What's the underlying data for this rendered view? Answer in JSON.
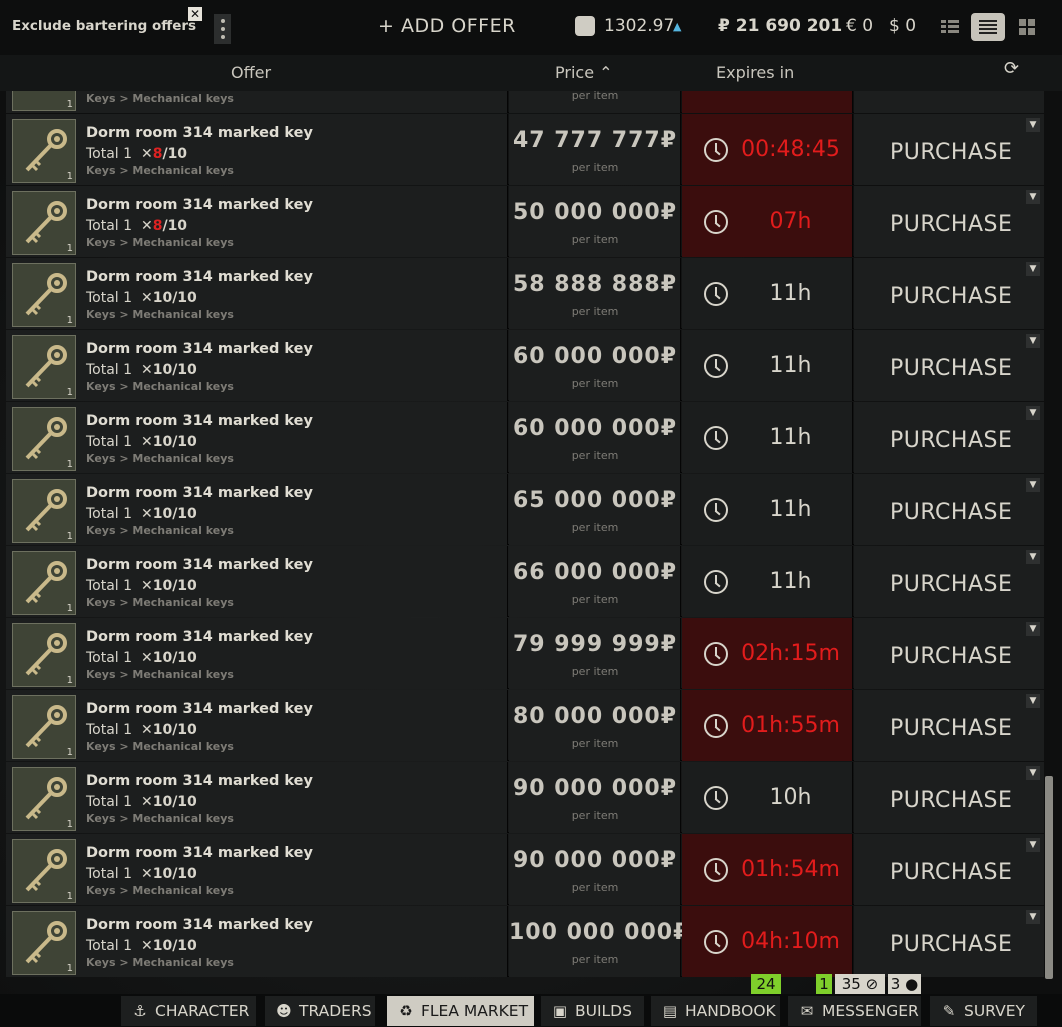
{
  "topbar": {
    "exclude_label": "Exclude bartering offers",
    "exclude_close": "✕",
    "add_offer": "+ ADD OFFER",
    "bsg_value": "1302.97",
    "bsg_arrow": "▲",
    "rubles": "₽ 21 690 201",
    "euros": "€ 0",
    "dollars": "$ 0"
  },
  "header": {
    "offer": "Offer",
    "price": "Price ⌃",
    "expires": "Expires in",
    "refresh_icon": "⟳"
  },
  "partial_row": {
    "category": "Keys > Mechanical keys",
    "per_item": "per item",
    "qty": "1"
  },
  "offers": [
    {
      "name": "Dorm room 314 marked key",
      "total": "Total 1",
      "dur_cur": "8",
      "dur_max": "/10",
      "dur_bad": true,
      "category": "Keys > Mechanical keys",
      "price": "47 777 777",
      "currency": "₽",
      "per_item": "per item",
      "expires": "00:48:45",
      "urgent": true,
      "action": "PURCHASE",
      "qty": "1"
    },
    {
      "name": "Dorm room 314 marked key",
      "total": "Total 1",
      "dur_cur": "8",
      "dur_max": "/10",
      "dur_bad": true,
      "category": "Keys > Mechanical keys",
      "price": "50 000 000",
      "currency": "₽",
      "per_item": "per item",
      "expires": "07h",
      "urgent": true,
      "action": "PURCHASE",
      "qty": "1"
    },
    {
      "name": "Dorm room 314 marked key",
      "total": "Total 1",
      "dur_cur": "10",
      "dur_max": "/10",
      "dur_bad": false,
      "category": "Keys > Mechanical keys",
      "price": "58 888 888",
      "currency": "₽",
      "per_item": "per item",
      "expires": "11h",
      "urgent": false,
      "action": "PURCHASE",
      "qty": "1"
    },
    {
      "name": "Dorm room 314 marked key",
      "total": "Total 1",
      "dur_cur": "10",
      "dur_max": "/10",
      "dur_bad": false,
      "category": "Keys > Mechanical keys",
      "price": "60 000 000",
      "currency": "₽",
      "per_item": "per item",
      "expires": "11h",
      "urgent": false,
      "action": "PURCHASE",
      "qty": "1"
    },
    {
      "name": "Dorm room 314 marked key",
      "total": "Total 1",
      "dur_cur": "10",
      "dur_max": "/10",
      "dur_bad": false,
      "category": "Keys > Mechanical keys",
      "price": "60 000 000",
      "currency": "₽",
      "per_item": "per item",
      "expires": "11h",
      "urgent": false,
      "action": "PURCHASE",
      "qty": "1"
    },
    {
      "name": "Dorm room 314 marked key",
      "total": "Total 1",
      "dur_cur": "10",
      "dur_max": "/10",
      "dur_bad": false,
      "category": "Keys > Mechanical keys",
      "price": "65 000 000",
      "currency": "₽",
      "per_item": "per item",
      "expires": "11h",
      "urgent": false,
      "action": "PURCHASE",
      "qty": "1"
    },
    {
      "name": "Dorm room 314 marked key",
      "total": "Total 1",
      "dur_cur": "10",
      "dur_max": "/10",
      "dur_bad": false,
      "category": "Keys > Mechanical keys",
      "price": "66 000 000",
      "currency": "₽",
      "per_item": "per item",
      "expires": "11h",
      "urgent": false,
      "action": "PURCHASE",
      "qty": "1"
    },
    {
      "name": "Dorm room 314 marked key",
      "total": "Total 1",
      "dur_cur": "10",
      "dur_max": "/10",
      "dur_bad": false,
      "category": "Keys > Mechanical keys",
      "price": "79 999 999",
      "currency": "₽",
      "per_item": "per item",
      "expires": "02h:15m",
      "urgent": true,
      "action": "PURCHASE",
      "qty": "1"
    },
    {
      "name": "Dorm room 314 marked key",
      "total": "Total 1",
      "dur_cur": "10",
      "dur_max": "/10",
      "dur_bad": false,
      "category": "Keys > Mechanical keys",
      "price": "80 000 000",
      "currency": "₽",
      "per_item": "per item",
      "expires": "01h:55m",
      "urgent": true,
      "action": "PURCHASE",
      "qty": "1"
    },
    {
      "name": "Dorm room 314 marked key",
      "total": "Total 1",
      "dur_cur": "10",
      "dur_max": "/10",
      "dur_bad": false,
      "category": "Keys > Mechanical keys",
      "price": "90 000 000",
      "currency": "₽",
      "per_item": "per item",
      "expires": "10h",
      "urgent": false,
      "action": "PURCHASE",
      "qty": "1"
    },
    {
      "name": "Dorm room 314 marked key",
      "total": "Total 1",
      "dur_cur": "10",
      "dur_max": "/10",
      "dur_bad": false,
      "category": "Keys > Mechanical keys",
      "price": "90 000 000",
      "currency": "₽",
      "per_item": "per item",
      "expires": "01h:54m",
      "urgent": true,
      "action": "PURCHASE",
      "qty": "1"
    },
    {
      "name": "Dorm room 314 marked key",
      "total": "Total 1",
      "dur_cur": "10",
      "dur_max": "/10",
      "dur_bad": false,
      "category": "Keys > Mechanical keys",
      "price": "100 000 000",
      "currency": "₽",
      "per_item": "per item",
      "expires": "04h:10m",
      "urgent": true,
      "action": "PURCHASE",
      "qty": "1"
    }
  ],
  "badges": {
    "handbook": "24",
    "messenger_new": "1",
    "messenger_attach": "35",
    "messenger_contacts": "3"
  },
  "nav": [
    {
      "label": "CHARACTER",
      "icon": "character-icon"
    },
    {
      "label": "TRADERS",
      "icon": "traders-icon"
    },
    {
      "label": "FLEA MARKET",
      "icon": "flea-market-icon",
      "active": true
    },
    {
      "label": "BUILDS",
      "icon": "builds-icon"
    },
    {
      "label": "HANDBOOK",
      "icon": "handbook-icon"
    },
    {
      "label": "MESSENGER",
      "icon": "messenger-icon"
    },
    {
      "label": "SURVEY",
      "icon": "survey-icon"
    }
  ],
  "colors": {
    "urgent_bg": "#3b0d0d",
    "urgent_text": "#e21c1c",
    "accent_green": "#7fcf2b",
    "active_nav": "#cfccc3"
  }
}
